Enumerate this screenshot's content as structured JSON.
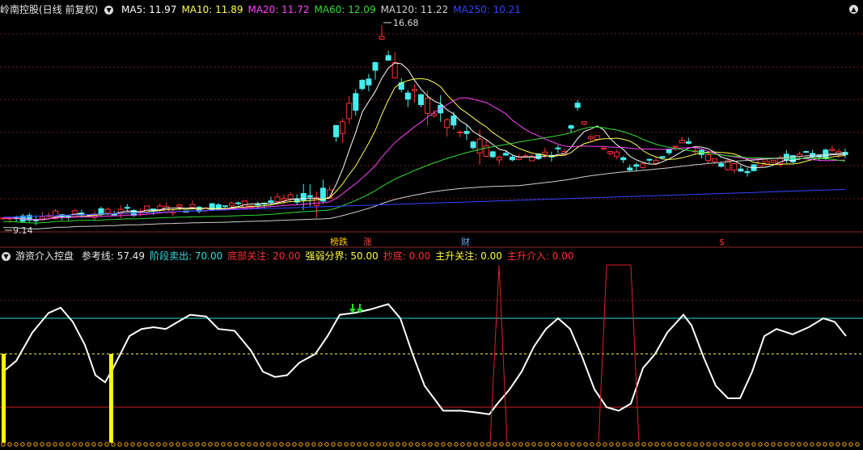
{
  "main_panel": {
    "title": "岭南控股(日线 前复权)",
    "ma": [
      {
        "label": "MA5: 11.97",
        "color": "#ffffff"
      },
      {
        "label": "MA10: 11.89",
        "color": "#ffff55"
      },
      {
        "label": "MA20: 11.72",
        "color": "#ff44ff"
      },
      {
        "label": "MA60: 12.09",
        "color": "#33dd33"
      },
      {
        "label": "MA120: 11.22",
        "color": "#d0d0d0"
      },
      {
        "label": "MA250: 10.21",
        "color": "#3344ff"
      }
    ],
    "high_label": "16.68",
    "low_label": "9.14",
    "event_tags": [
      {
        "text": "榜跌",
        "color": "#ffcc00"
      },
      {
        "text": "涨",
        "color": "#ff4444"
      },
      {
        "text": "财",
        "color": "#66aaff"
      },
      {
        "text": "$",
        "color": "#ff3333"
      }
    ]
  },
  "indicator_panel": {
    "title": "游资介入控盘",
    "params": [
      {
        "label": "参考线: 57.49",
        "color": "#e8e8e8"
      },
      {
        "label": "阶段卖出: 70.00",
        "color": "#33dddd"
      },
      {
        "label": "底部关注: 20.00",
        "color": "#ff3333"
      },
      {
        "label": "强弱分界: 50.00",
        "color": "#ffff44"
      },
      {
        "label": "抄底: 0.00",
        "color": "#ff3333"
      },
      {
        "label": "主升关注: 0.00",
        "color": "#ffff44"
      },
      {
        "label": "主升介入: 0.00",
        "color": "#ff3333"
      }
    ]
  },
  "colors": {
    "up_candle": "#ff3333",
    "down_candle": "#44eeee",
    "grid": "#7a1a1a",
    "sell_line": "#33dddd",
    "bottom_line": "#cc2222",
    "divide_line": "#ffff44",
    "osc_line": "#ffffff"
  }
}
